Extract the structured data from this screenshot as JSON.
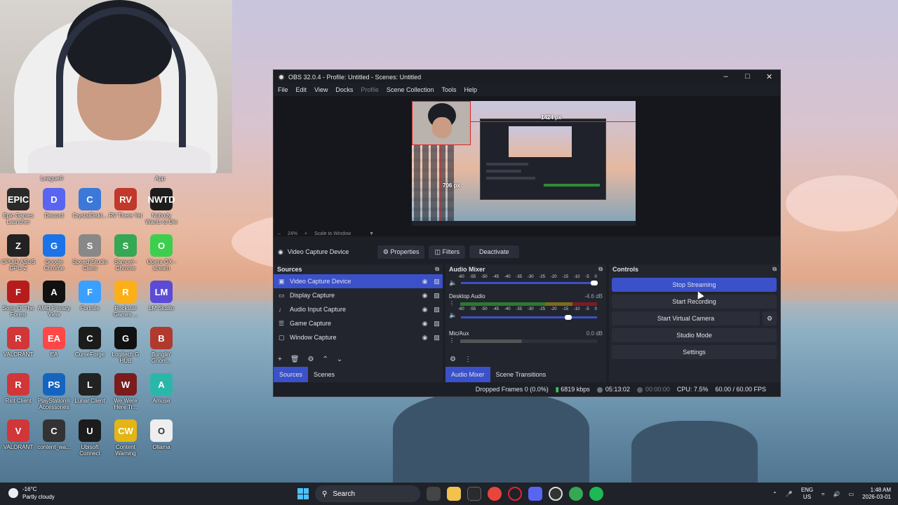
{
  "obs": {
    "title": "OBS 32.0.4 - Profile: Untitled - Scenes: Untitled",
    "menu": [
      "File",
      "Edit",
      "View",
      "Docks",
      "Profile",
      "Scene Collection",
      "Tools",
      "Help"
    ],
    "preview_labels": {
      "width_px": "1424 px",
      "height_px": "706 px"
    },
    "zoom": {
      "level": "24%",
      "mode": "Scale to Window"
    },
    "source_toolbar": {
      "selected_source": "Video Capture Device",
      "properties": "Properties",
      "filters": "Filters",
      "deactivate": "Deactivate"
    },
    "sources": {
      "title": "Sources",
      "items": [
        {
          "name": "Video Capture Device",
          "icon": "camera-icon"
        },
        {
          "name": "Display Capture",
          "icon": "monitor-icon"
        },
        {
          "name": "Audio Input Capture",
          "icon": "microphone-icon"
        },
        {
          "name": "Game Capture",
          "icon": "gamepad-icon"
        },
        {
          "name": "Window Capture",
          "icon": "window-icon"
        }
      ],
      "tabs": [
        "Sources",
        "Scenes"
      ]
    },
    "audio_mixer": {
      "title": "Audio Mixer",
      "scale": [
        "-60",
        "-55",
        "-50",
        "-45",
        "-40",
        "-35",
        "-30",
        "-25",
        "-20",
        "-15",
        "-10",
        "-5",
        "0"
      ],
      "channels": [
        {
          "name": "Desktop Audio",
          "level": "-4.6 dB"
        },
        {
          "name": "Mic/Aux",
          "level": "0.0 dB"
        }
      ],
      "tabs": [
        "Audio Mixer",
        "Scene Transitions"
      ]
    },
    "controls": {
      "title": "Controls",
      "stop_streaming": "Stop Streaming",
      "start_recording": "Start Recording",
      "start_virtual_camera": "Start Virtual Camera",
      "studio_mode": "Studio Mode",
      "settings": "Settings"
    },
    "status": {
      "dropped_frames": "Dropped Frames 0 (0.0%)",
      "bitrate": "6819 kbps",
      "stream_time": "05:13:02",
      "rec_time": "00:00:00",
      "cpu": "CPU: 7.5%",
      "fps": "60.00 / 60.00 FPS"
    }
  },
  "desktop": {
    "partial_labels": [
      "League®",
      "App"
    ],
    "icons": [
      {
        "label": "Epic Games Launcher",
        "glyph": "EPIC",
        "color": "#2a2a2a"
      },
      {
        "label": "Discord",
        "glyph": "D",
        "color": "#5865f2"
      },
      {
        "label": "CrystalDiskI...",
        "glyph": "C",
        "color": "#3c78d8"
      },
      {
        "label": "RV There Yet",
        "glyph": "RV",
        "color": "#c0392b"
      },
      {
        "label": "Nobody Wants to Die",
        "glyph": "NWTD",
        "color": "#1d1d1d"
      },
      {
        "label": "CPUID ASUS GPU-Z",
        "glyph": "Z",
        "color": "#222"
      },
      {
        "label": "Google Chrome",
        "glyph": "G",
        "color": "#1a73e8"
      },
      {
        "label": "SpeechStudio Client",
        "glyph": "S",
        "color": "#888"
      },
      {
        "label": "Samuel - Chrome",
        "glyph": "S",
        "color": "#34a853"
      },
      {
        "label": "Opera GX - stream",
        "glyph": "O",
        "color": "#3ccf4e"
      },
      {
        "label": "Sons Of The Forest",
        "glyph": "F",
        "color": "#b71c1c"
      },
      {
        "label": "AMD Privacy View",
        "glyph": "A",
        "color": "#111"
      },
      {
        "label": "Fortnite",
        "glyph": "F",
        "color": "#3aa0ff"
      },
      {
        "label": "Rockstar Games ...",
        "glyph": "R",
        "color": "#fcaf17"
      },
      {
        "label": "LM Studio",
        "glyph": "LM",
        "color": "#5b4bd6"
      },
      {
        "label": "VALORANT",
        "glyph": "R",
        "color": "#d13639"
      },
      {
        "label": "EA",
        "glyph": "EA",
        "color": "#ff4747"
      },
      {
        "label": "CurseForge",
        "glyph": "C",
        "color": "#1b1b1b"
      },
      {
        "label": "Logitech G HUB",
        "glyph": "G",
        "color": "#111"
      },
      {
        "label": "Bunglin' Gnom...",
        "glyph": "B",
        "color": "#b03a2e"
      },
      {
        "label": "Riot Client",
        "glyph": "R",
        "color": "#d13639"
      },
      {
        "label": "PlayStation® Accessories",
        "glyph": "PS",
        "color": "#1565c0"
      },
      {
        "label": "Lunar Client",
        "glyph": "L",
        "color": "#222"
      },
      {
        "label": "We Were Here Tr...",
        "glyph": "W",
        "color": "#7b1c1c"
      },
      {
        "label": "Amuse",
        "glyph": "A",
        "color": "#2ab7a9"
      },
      {
        "label": "VALORANT",
        "glyph": "V",
        "color": "#d13639"
      },
      {
        "label": "content_wa...",
        "glyph": "C",
        "color": "#333"
      },
      {
        "label": "Ubisoft Connect",
        "glyph": "U",
        "color": "#1c1c1c"
      },
      {
        "label": "Content Warning",
        "glyph": "CW",
        "color": "#e3b515"
      },
      {
        "label": "Ollama",
        "glyph": "O",
        "color": "#eee"
      }
    ]
  },
  "taskbar": {
    "weather_temp": "-16°C",
    "weather_desc": "Partly cloudy",
    "search_placeholder": "Search",
    "lang_top": "ENG",
    "lang_bottom": "US",
    "time": "1:48 AM",
    "date": "2026-03-01"
  }
}
